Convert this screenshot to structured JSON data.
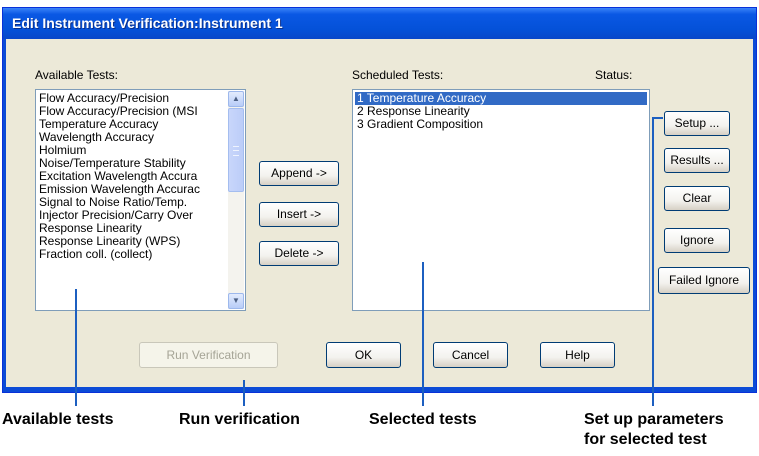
{
  "window": {
    "title": "Edit Instrument Verification:Instrument 1"
  },
  "labels": {
    "available_tests": "Available Tests:",
    "scheduled_tests": "Scheduled Tests:",
    "status": "Status:"
  },
  "available_tests": [
    "Flow Accuracy/Precision",
    "Flow Accuracy/Precision (MSI",
    "Temperature Accuracy",
    "Wavelength Accuracy",
    "Holmium",
    "Noise/Temperature Stability",
    "Excitation Wavelength Accura",
    "Emission Wavelength Accurac",
    "Signal to Noise Ratio/Temp.",
    "Injector Precision/Carry Over",
    "Response Linearity",
    "Response Linearity (WPS)",
    "Fraction coll. (collect)"
  ],
  "scheduled_tests": [
    {
      "label": "1  Temperature Accuracy",
      "selected": true
    },
    {
      "label": "2  Response Linearity",
      "selected": false
    },
    {
      "label": "3  Gradient Composition",
      "selected": false
    }
  ],
  "middle_buttons": {
    "append": "Append ->",
    "insert": "Insert ->",
    "delete": "Delete ->"
  },
  "right_buttons": {
    "setup": "Setup ...",
    "results": "Results ...",
    "clear": "Clear",
    "ignore": "Ignore",
    "failed_ignore": "Failed Ignore"
  },
  "bottom_buttons": {
    "run_verification": "Run Verification",
    "ok": "OK",
    "cancel": "Cancel",
    "help": "Help"
  },
  "captions": {
    "available_tests": "Available tests",
    "run_verification": "Run verification",
    "selected_tests": "Selected tests",
    "setup_line1": "Set up parameters",
    "setup_line2": "for selected test"
  },
  "colors": {
    "callout": "#1c5fc0",
    "selection": "#316ac5",
    "dialog_face": "#ece9d8",
    "title_bar": "#0451d8"
  }
}
